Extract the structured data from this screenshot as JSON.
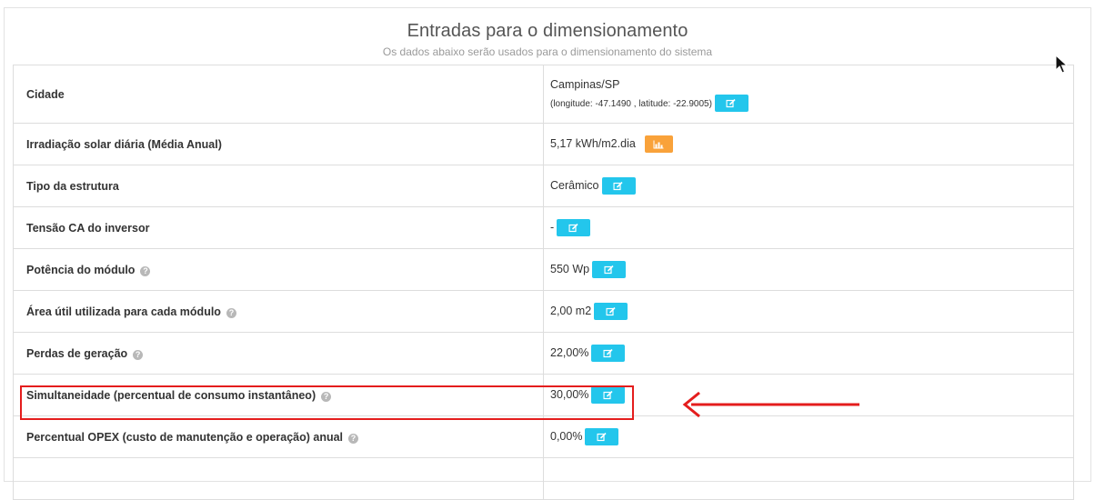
{
  "header": {
    "title": "Entradas para o dimensionamento",
    "subtitle": "Os dados abaixo serão usados para o dimensionamento do sistema"
  },
  "rows": [
    {
      "label": "Cidade",
      "value": "Campinas/SP",
      "detail": "(longitude: -47.1490 , latitude: -22.9005)",
      "help": false,
      "button": "edit-icon"
    },
    {
      "label": "Irradiação solar diária (Média Anual)",
      "value": "5,17 kWh/m2.dia",
      "help": false,
      "button": "chart-icon"
    },
    {
      "label": "Tipo da estrutura",
      "value": "Cerâmico",
      "help": false,
      "button": "edit-icon"
    },
    {
      "label": "Tensão CA do inversor",
      "value": "-",
      "help": false,
      "button": "edit-icon"
    },
    {
      "label": "Potência do módulo",
      "value": "550 Wp",
      "help": true,
      "button": "edit-icon"
    },
    {
      "label": "Área útil utilizada para cada módulo",
      "value": "2,00 m2",
      "help": true,
      "button": "edit-icon"
    },
    {
      "label": "Perdas de geração",
      "value": "22,00%",
      "help": true,
      "button": "edit-icon"
    },
    {
      "label": "Simultaneidade (percentual de consumo instantâneo)",
      "value": "30,00%",
      "help": true,
      "button": "edit-icon",
      "highlighted": true
    },
    {
      "label": "Percentual OPEX (custo de manutenção e operação) anual",
      "value": "0,00%",
      "help": true,
      "button": "edit-icon"
    }
  ],
  "help_glyph": "?",
  "colors": {
    "edit_button": "#23c6ec",
    "chart_button": "#f9a23a",
    "highlight": "#e41d1d"
  }
}
